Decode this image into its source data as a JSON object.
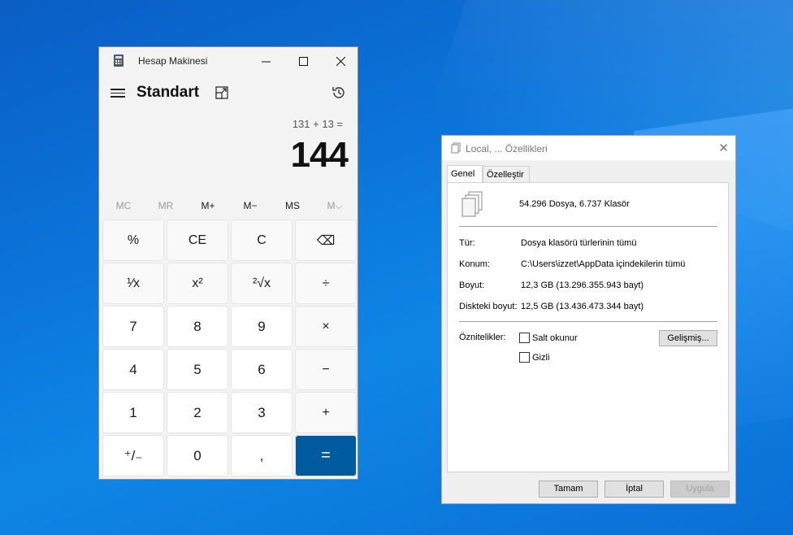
{
  "calculator": {
    "title": "Hesap Makinesi",
    "mode": "Standart",
    "expression": "131 + 13 =",
    "result": "144",
    "window_controls": {
      "minimize": "—",
      "maximize": "☐",
      "close": "✕"
    },
    "memory": [
      {
        "label": "MC",
        "enabled": false
      },
      {
        "label": "MR",
        "enabled": false
      },
      {
        "label": "M+",
        "enabled": true
      },
      {
        "label": "M−",
        "enabled": true
      },
      {
        "label": "MS",
        "enabled": true
      },
      {
        "label": "M⌵",
        "enabled": false
      }
    ],
    "keys": [
      {
        "label": "%",
        "kind": "fn",
        "name": "percent-key"
      },
      {
        "label": "CE",
        "kind": "fn",
        "name": "clear-entry-key"
      },
      {
        "label": "C",
        "kind": "fn",
        "name": "clear-key"
      },
      {
        "label": "⌫",
        "kind": "fn",
        "name": "backspace-key"
      },
      {
        "label": "¹⁄x",
        "kind": "fn",
        "name": "reciprocal-key"
      },
      {
        "label": "x²",
        "kind": "fn",
        "name": "square-key"
      },
      {
        "label": "²√x",
        "kind": "fn",
        "name": "square-root-key"
      },
      {
        "label": "÷",
        "kind": "fn",
        "name": "divide-key"
      },
      {
        "label": "7",
        "kind": "num",
        "name": "digit-7-key"
      },
      {
        "label": "8",
        "kind": "num",
        "name": "digit-8-key"
      },
      {
        "label": "9",
        "kind": "num",
        "name": "digit-9-key"
      },
      {
        "label": "×",
        "kind": "fn",
        "name": "multiply-key"
      },
      {
        "label": "4",
        "kind": "num",
        "name": "digit-4-key"
      },
      {
        "label": "5",
        "kind": "num",
        "name": "digit-5-key"
      },
      {
        "label": "6",
        "kind": "num",
        "name": "digit-6-key"
      },
      {
        "label": "−",
        "kind": "fn",
        "name": "subtract-key"
      },
      {
        "label": "1",
        "kind": "num",
        "name": "digit-1-key"
      },
      {
        "label": "2",
        "kind": "num",
        "name": "digit-2-key"
      },
      {
        "label": "3",
        "kind": "num",
        "name": "digit-3-key"
      },
      {
        "label": "+",
        "kind": "fn",
        "name": "add-key"
      },
      {
        "label": "⁺/₋",
        "kind": "num",
        "name": "negate-key"
      },
      {
        "label": "0",
        "kind": "num",
        "name": "digit-0-key"
      },
      {
        "label": ",",
        "kind": "num",
        "name": "decimal-key"
      },
      {
        "label": "=",
        "kind": "eq",
        "name": "equals-key"
      }
    ]
  },
  "properties": {
    "title": "Local, ... Özellikleri",
    "close": "✕",
    "tabs": [
      "Genel",
      "Özelleştir"
    ],
    "summary": "54.296 Dosya, 6.737 Klasör",
    "rows": [
      {
        "label": "Tür:",
        "value": "Dosya klasörü türlerinin tümü"
      },
      {
        "label": "Konum:",
        "value": "C:\\Users\\izzet\\AppData içindekilerin tümü"
      },
      {
        "label": "Boyut:",
        "value": "12,3 GB (13.296.355.943 bayt)"
      },
      {
        "label": "Diskteki boyut:",
        "value": "12,5 GB (13.436.473.344 bayt)"
      }
    ],
    "attributes_label": "Öznitelikler:",
    "readonly_label": "Salt okunur",
    "hidden_label": "Gizli",
    "advanced_button": "Gelişmiş...",
    "ok_button": "Tamam",
    "cancel_button": "İptal",
    "apply_button": "Uygula"
  }
}
